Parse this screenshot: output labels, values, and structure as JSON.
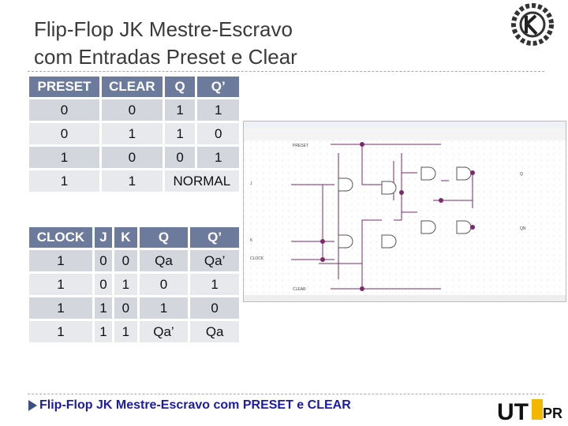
{
  "title_line1": "Flip-Flop JK Mestre-Escravo",
  "title_line2": "com Entradas Preset e Clear",
  "table1": {
    "headers": [
      "PRESET",
      "CLEAR",
      "Q",
      "Q’"
    ],
    "rows": [
      [
        "0",
        "0",
        "1",
        "1"
      ],
      [
        "0",
        "1",
        "1",
        "0"
      ],
      [
        "1",
        "0",
        "0",
        "1"
      ],
      [
        "1",
        "1",
        "NORMAL"
      ]
    ]
  },
  "table2": {
    "headers": [
      "CLOCK",
      "J",
      "K",
      "Q",
      "Q’"
    ],
    "rows": [
      [
        "1",
        "0",
        "0",
        "Qa",
        "Qa’"
      ],
      [
        "1",
        "0",
        "1",
        "0",
        "1"
      ],
      [
        "1",
        "1",
        "0",
        "1",
        "0"
      ],
      [
        "1",
        "1",
        "1",
        "Qa’",
        "Qa"
      ]
    ]
  },
  "schematic": {
    "labels": {
      "preset": "PRESET",
      "j": "J",
      "k": "K",
      "clock": "CLOCK",
      "clear": "CLEAR",
      "q": "Q",
      "qn": "QN"
    },
    "wire_color": "#7a2a6a"
  },
  "caption": "Flip-Flop JK Mestre-Escravo com PRESET e CLEAR",
  "logos": {
    "top": "university-gear-logo",
    "bottom": "UTFPR"
  }
}
